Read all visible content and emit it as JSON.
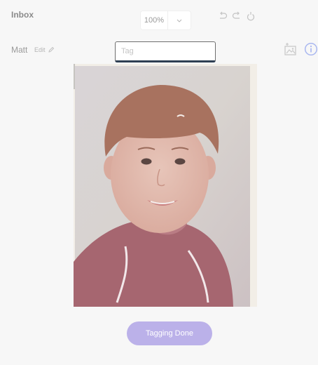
{
  "header": {
    "title": "Inbox",
    "zoom": "100%",
    "icons": [
      "undo-icon",
      "redo-icon",
      "rotate-icon"
    ]
  },
  "subject": {
    "name": "Matt",
    "edit_label": "Edit",
    "edit_icon": "pencil-icon"
  },
  "tag_input": {
    "placeholder": "Tag",
    "value": ""
  },
  "side_icons": [
    "add-photo-icon",
    "info-icon"
  ],
  "photo": {
    "icon": "portrait-photo"
  },
  "footer": {
    "done_label": "Tagging Done"
  },
  "colors": {
    "accent": "#bbb1e9",
    "info": "#a9b7f0",
    "background": "#f7f7f7"
  }
}
